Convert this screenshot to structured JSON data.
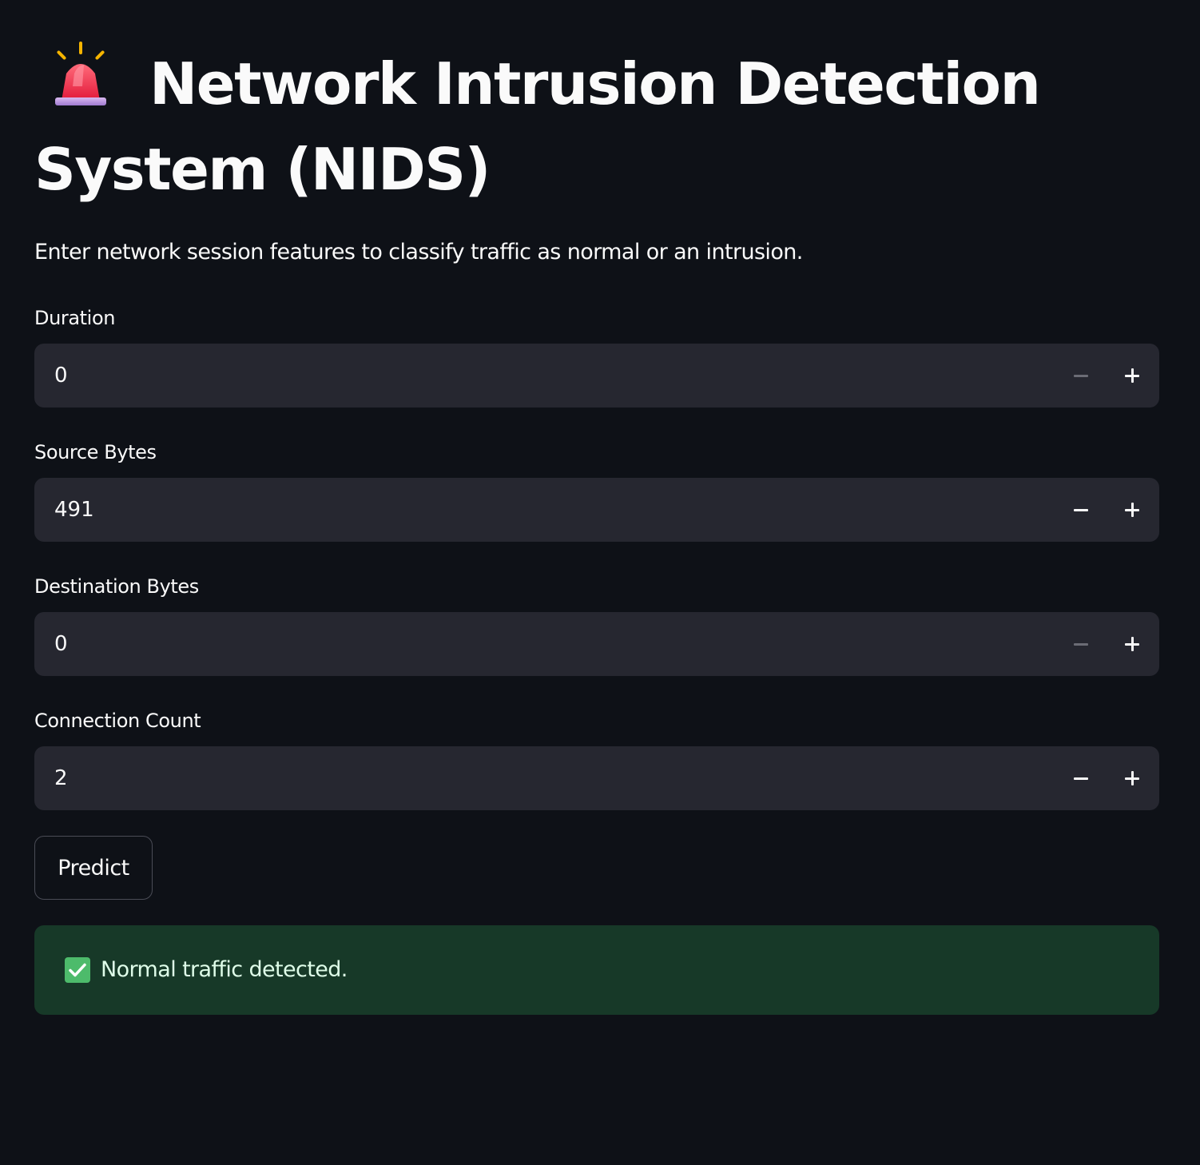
{
  "page": {
    "title": "Network Intrusion Detection System (NIDS)",
    "title_icon": "police-car-light-icon",
    "subtitle": "Enter network session features to classify traffic as normal or an intrusion."
  },
  "fields": [
    {
      "label": "Duration",
      "value": "0",
      "minus_enabled": false
    },
    {
      "label": "Source Bytes",
      "value": "491",
      "minus_enabled": true
    },
    {
      "label": "Destination Bytes",
      "value": "0",
      "minus_enabled": false
    },
    {
      "label": "Connection Count",
      "value": "2",
      "minus_enabled": true
    }
  ],
  "actions": {
    "predict_label": "Predict"
  },
  "result": {
    "icon": "check-mark-icon",
    "message": "Normal traffic detected."
  },
  "colors": {
    "background": "#0e1117",
    "input_background": "#262730",
    "success_background": "#173928",
    "success_text": "#dffde9",
    "check_green": "#4dbb6b"
  }
}
